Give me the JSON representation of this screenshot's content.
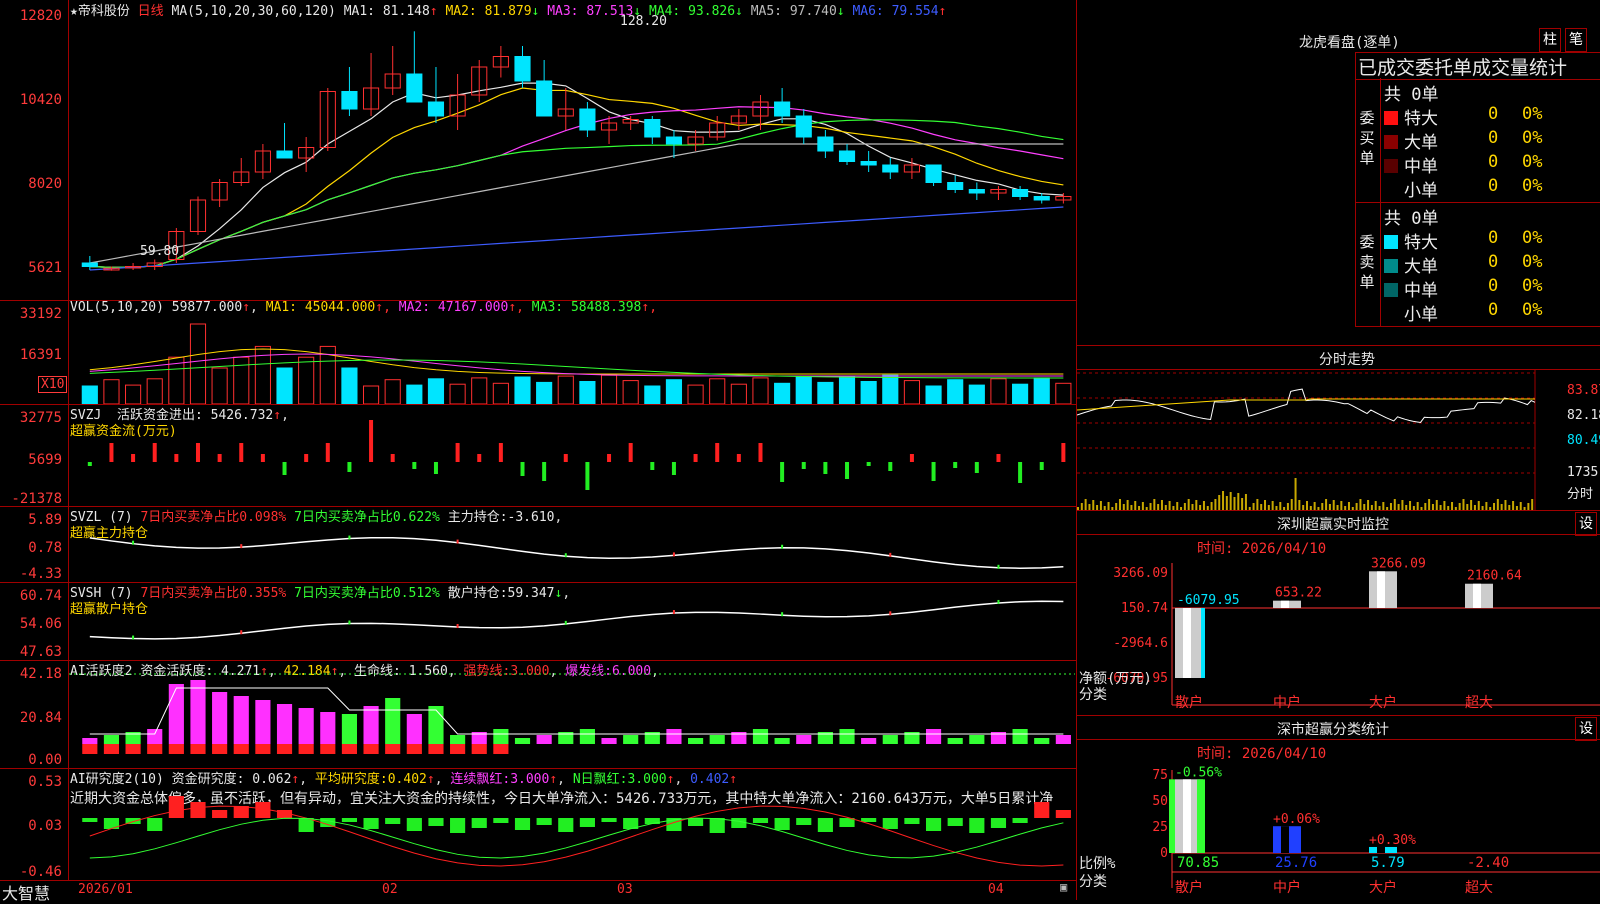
{
  "stock": {
    "name": "★帝科股份",
    "period": "日线"
  },
  "ma_line": {
    "prefix": "MA(5,10,20,30,60,120)",
    "items": [
      {
        "label": "MA1:",
        "value": "81.148",
        "arrow": "↑",
        "color": "#e8e8e8"
      },
      {
        "label": "MA2:",
        "value": "81.879",
        "arrow": "↓",
        "color": "#ffd700"
      },
      {
        "label": "MA3:",
        "value": "87.513",
        "arrow": "↓",
        "color": "#ff40ff"
      },
      {
        "label": "MA4:",
        "value": "93.826",
        "arrow": "↓",
        "color": "#33ff33"
      },
      {
        "label": "MA5:",
        "value": "97.740",
        "arrow": "↓",
        "color": "#bbbbbb"
      },
      {
        "label": "MA6:",
        "value": "79.554",
        "arrow": "↑",
        "color": "#3d5cff"
      }
    ],
    "high_mark": "128.20",
    "low_mark": "59.80"
  },
  "price_axis": [
    "12820",
    "10420",
    "8020",
    "5621"
  ],
  "vol": {
    "prefix": "VOL(5,10,20)",
    "value": "59877.000",
    "arrow": "↑",
    "ma": [
      {
        "label": "MA1:",
        "value": "45044.000",
        "arrow": "↑",
        "color": "#ffd700"
      },
      {
        "label": "MA2:",
        "value": "47167.000",
        "arrow": "↑",
        "color": "#ff40ff"
      },
      {
        "label": "MA3:",
        "value": "58488.398",
        "arrow": "↑",
        "color": "#33ff33"
      }
    ],
    "axis": [
      "33192",
      "16391"
    ],
    "unit": "X10"
  },
  "svzj": {
    "prefix": "SVZJ",
    "label": "活跃资金进出:",
    "value": "5426.732",
    "arrow": "↑",
    "sub": "超赢资金流(万元)",
    "axis": [
      "32775",
      "5699",
      "-21378"
    ]
  },
  "svzl": {
    "prefix": "SVZL (7)",
    "a": "7日内买卖净占比0.098%",
    "b": "7日内买卖净占比0.622%",
    "c": "主力持仓:",
    "c_val": "-3.610",
    "sub": "超赢主力持仓",
    "axis": [
      "5.89",
      "0.78",
      "-4.33"
    ]
  },
  "svsh": {
    "prefix": "SVSH (7)",
    "a": "7日内买卖净占比0.355%",
    "b": "7日内买卖净占比0.512%",
    "c": "散户持仓:",
    "c_val": "59.347",
    "arrow": "↓",
    "sub": "超赢散户持仓",
    "axis": [
      "60.74",
      "54.06",
      "47.63"
    ]
  },
  "ai1": {
    "prefix": "AI活跃度2",
    "label": "资金活跃度:",
    "value": "4.271",
    "v2": "42.184",
    "l3": "生命线:",
    "v3": "1.560",
    "l4": "强势线:",
    "v4": "3.000",
    "l5": "爆发线:",
    "v5": "6.000",
    "axis": [
      "42.18",
      "20.84",
      "0.00"
    ]
  },
  "ai2": {
    "prefix": "AI研究度2(10)",
    "l1": "资金研究度:",
    "v1": "0.062",
    "l2": "平均研究度:",
    "v2": "0.402",
    "l3": "连续飘红:",
    "v3": "3.000",
    "l4": "N日飘红:",
    "v4": "3.000",
    "v5": "0.402",
    "comment": "近期大资金总体偏多，虽不活跃，但有异动，宜关注大资金的持续性，今日大单净流入：5426.733万元，其中特大单净流入：2160.643万元，大单5日累计净",
    "axis": [
      "0.53",
      "0.03",
      "-0.46"
    ]
  },
  "xaxis": {
    "logo": "大智慧",
    "dates": [
      "2026/01",
      "02",
      "03",
      "04"
    ]
  },
  "lhb": {
    "title": "龙虎看盘(逐单)",
    "btn1": "柱",
    "btn2": "笔",
    "subtitle": "已成交委托单成交量统计",
    "buy": {
      "side": "委买单",
      "total": "共 0单",
      "rows": [
        {
          "name": "特大",
          "count": "0",
          "pct": "0%",
          "color": "#ff1010"
        },
        {
          "name": "大单",
          "count": "0",
          "pct": "0%",
          "color": "#8b0000"
        },
        {
          "name": "中单",
          "count": "0",
          "pct": "0%",
          "color": "#5a0000"
        },
        {
          "name": "小单",
          "count": "0",
          "pct": "0%",
          "color": ""
        }
      ]
    },
    "sell": {
      "side": "委卖单",
      "total": "共 0单",
      "rows": [
        {
          "name": "特大",
          "count": "0",
          "pct": "0%",
          "color": "#00e5ff"
        },
        {
          "name": "大单",
          "count": "0",
          "pct": "0%",
          "color": "#008b8b"
        },
        {
          "name": "中单",
          "count": "0",
          "pct": "0%",
          "color": "#006666"
        },
        {
          "name": "小单",
          "count": "0",
          "pct": "0%",
          "color": ""
        }
      ]
    }
  },
  "intraday": {
    "title": "分时走势",
    "axis": [
      "83.87",
      "82.18",
      "80.49",
      "1735"
    ],
    "label": "分时"
  },
  "sz_monitor": {
    "title": "深圳超赢实时监控",
    "btn": "设",
    "time": "时间: 2026/04/10",
    "axis": [
      "3266.09",
      "150.74",
      "-2964.6",
      "-6079.95"
    ],
    "ylab1": "净额(万元)",
    "ylab2": "分类",
    "bars": [
      {
        "cat": "散户",
        "value": -6079.95,
        "label": "-6079.95"
      },
      {
        "cat": "中户",
        "value": 653.22,
        "label": "653.22"
      },
      {
        "cat": "大户",
        "value": 3266.09,
        "label": "3266.09"
      },
      {
        "cat": "超大",
        "value": 2160.64,
        "label": "2160.64"
      }
    ]
  },
  "sz_class": {
    "title": "深市超赢分类统计",
    "btn": "设",
    "time": "时间: 2026/04/10",
    "axis": [
      "75",
      "50",
      "25",
      "0"
    ],
    "ylab1": "比例%",
    "ylab2": "分类",
    "bars": [
      {
        "cat": "散户",
        "value": 70.85,
        "label": "70.85",
        "top": "-0.56%",
        "color": "#33ff33"
      },
      {
        "cat": "中户",
        "value": 25.76,
        "label": "25.76",
        "top": "+0.06%",
        "color": "#2040ff"
      },
      {
        "cat": "大户",
        "value": 5.79,
        "label": "5.79",
        "top": "+0.30%",
        "color": "#00e5ff"
      },
      {
        "cat": "超大",
        "value": -2.4,
        "label": "-2.40",
        "top": "",
        "color": "#ff3030"
      }
    ]
  },
  "chart_data": {
    "type": "candlestick",
    "ohlc_approx": [
      [
        62,
        64,
        60,
        61
      ],
      [
        60,
        61,
        59.8,
        60.5
      ],
      [
        61,
        62,
        60,
        61
      ],
      [
        61,
        63,
        60,
        62
      ],
      [
        63,
        72,
        62,
        71
      ],
      [
        71,
        81,
        70,
        80
      ],
      [
        80,
        86,
        78,
        85
      ],
      [
        85,
        92,
        84,
        88
      ],
      [
        88,
        96,
        86,
        94
      ],
      [
        94,
        102,
        92,
        92
      ],
      [
        92,
        98,
        88,
        95
      ],
      [
        95,
        112,
        94,
        111
      ],
      [
        111,
        118,
        104,
        106
      ],
      [
        106,
        122,
        104,
        112
      ],
      [
        112,
        124,
        110,
        116
      ],
      [
        116,
        128.2,
        110,
        108
      ],
      [
        108,
        118,
        102,
        104
      ],
      [
        104,
        116,
        100,
        110
      ],
      [
        110,
        120,
        108,
        118
      ],
      [
        118,
        124,
        115,
        121
      ],
      [
        121,
        124,
        112,
        114
      ],
      [
        114,
        120,
        104,
        104
      ],
      [
        104,
        112,
        100,
        106
      ],
      [
        106,
        108,
        98,
        100
      ],
      [
        100,
        104,
        96,
        102
      ],
      [
        102,
        104,
        100,
        103
      ],
      [
        103,
        104,
        96,
        98
      ],
      [
        98,
        100,
        92,
        96
      ],
      [
        96,
        100,
        94,
        98
      ],
      [
        98,
        104,
        97,
        102
      ],
      [
        102,
        106,
        100,
        104
      ],
      [
        104,
        110,
        100,
        108
      ],
      [
        108,
        112,
        102,
        104
      ],
      [
        104,
        106,
        96,
        98
      ],
      [
        98,
        100,
        92,
        94
      ],
      [
        94,
        96,
        90,
        91
      ],
      [
        91,
        94,
        88,
        90
      ],
      [
        90,
        92,
        86,
        88
      ],
      [
        88,
        92,
        86,
        90
      ],
      [
        90,
        90,
        84,
        85
      ],
      [
        85,
        87,
        82,
        83
      ],
      [
        83,
        85,
        80,
        82
      ],
      [
        82,
        84,
        80,
        83
      ],
      [
        83,
        84,
        80,
        81
      ],
      [
        81,
        82,
        79,
        80
      ],
      [
        80,
        82,
        79,
        81
      ]
    ]
  }
}
